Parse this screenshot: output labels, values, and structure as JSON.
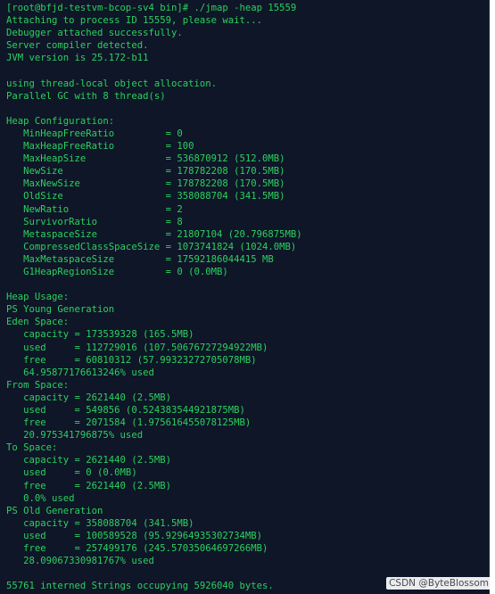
{
  "terminal": {
    "lines": [
      "[root@bfjd-testvm-bcop-sv4 bin]# ./jmap -heap 15559",
      "Attaching to process ID 15559, please wait...",
      "Debugger attached successfully.",
      "Server compiler detected.",
      "JVM version is 25.172-b11",
      "",
      "using thread-local object allocation.",
      "Parallel GC with 8 thread(s)",
      "",
      "Heap Configuration:",
      "   MinHeapFreeRatio         = 0",
      "   MaxHeapFreeRatio         = 100",
      "   MaxHeapSize              = 536870912 (512.0MB)",
      "   NewSize                  = 178782208 (170.5MB)",
      "   MaxNewSize               = 178782208 (170.5MB)",
      "   OldSize                  = 358088704 (341.5MB)",
      "   NewRatio                 = 2",
      "   SurvivorRatio            = 8",
      "   MetaspaceSize            = 21807104 (20.796875MB)",
      "   CompressedClassSpaceSize = 1073741824 (1024.0MB)",
      "   MaxMetaspaceSize         = 17592186044415 MB",
      "   G1HeapRegionSize         = 0 (0.0MB)",
      "",
      "Heap Usage:",
      "PS Young Generation",
      "Eden Space:",
      "   capacity = 173539328 (165.5MB)",
      "   used     = 112729016 (107.50676727294922MB)",
      "   free     = 60810312 (57.99323272705078MB)",
      "   64.95877176613246% used",
      "From Space:",
      "   capacity = 2621440 (2.5MB)",
      "   used     = 549856 (0.524383544921875MB)",
      "   free     = 2071584 (1.975616455078125MB)",
      "   20.975341796875% used",
      "To Space:",
      "   capacity = 2621440 (2.5MB)",
      "   used     = 0 (0.0MB)",
      "   free     = 2621440 (2.5MB)",
      "   0.0% used",
      "PS Old Generation",
      "   capacity = 358088704 (341.5MB)",
      "   used     = 100589528 (95.92964935302734MB)",
      "   free     = 257499176 (245.57035064697266MB)",
      "   28.09067330981767% used",
      "",
      "55761 interned Strings occupying 5926040 bytes."
    ]
  },
  "watermark": {
    "text": "CSDN @ByteBlossom"
  },
  "colors": {
    "background": "#0f1628",
    "text": "#2bd15e"
  }
}
